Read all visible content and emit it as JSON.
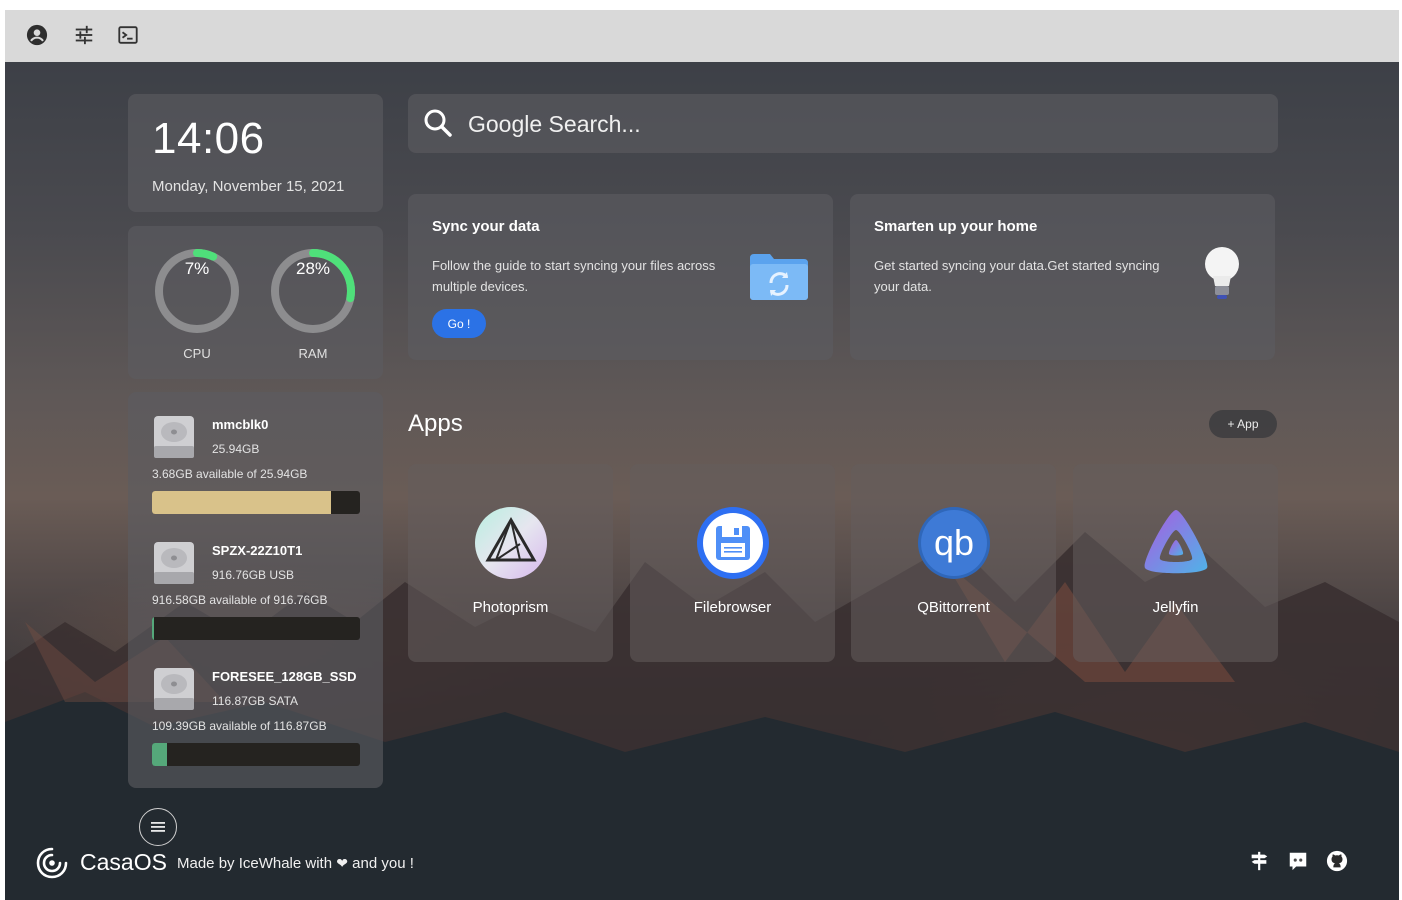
{
  "topbar": {
    "icons": [
      "account-icon",
      "sliders-icon",
      "terminal-icon"
    ]
  },
  "clock": {
    "time": "14:06",
    "date": "Monday, November 15, 2021"
  },
  "gauges": [
    {
      "label": "CPU",
      "value_text": "7%",
      "percent": 7
    },
    {
      "label": "RAM",
      "value_text": "28%",
      "percent": 28
    }
  ],
  "gauge_colors": {
    "track": "#8d8d8f",
    "fill": "#4fe07a"
  },
  "disks": [
    {
      "name": "mmcblk0",
      "size": "25.94GB",
      "available": "3.68GB available of 25.94GB",
      "used_fraction": 0.86,
      "fill_color": "#d9c28a"
    },
    {
      "name": "SPZX-22Z10T1",
      "size": "916.76GB USB",
      "available": "916.58GB available of 916.76GB",
      "used_fraction": 0.01,
      "fill_color": "#55a87a"
    },
    {
      "name": "FORESEE_128GB_SSD",
      "size": "116.87GB SATA",
      "available": "109.39GB available of 116.87GB",
      "used_fraction": 0.07,
      "fill_color": "#55a87a"
    }
  ],
  "search": {
    "placeholder": "Google Search..."
  },
  "cards": [
    {
      "title": "Sync your data",
      "description": "Follow the guide to start syncing your files across multiple devices.",
      "button": "Go !",
      "icon": "folder-sync-icon"
    },
    {
      "title": "Smarten up your home",
      "description": "Get started syncing your data.Get started syncing your data.",
      "icon": "lightbulb-icon"
    }
  ],
  "apps_section": {
    "title": "Apps",
    "add_label": "+ App"
  },
  "apps": [
    {
      "name": "Photoprism",
      "icon": "photoprism-icon"
    },
    {
      "name": "Filebrowser",
      "icon": "filebrowser-icon"
    },
    {
      "name": "QBittorrent",
      "icon": "qbittorrent-icon"
    },
    {
      "name": "Jellyfin",
      "icon": "jellyfin-icon"
    }
  ],
  "footer": {
    "brand": "CasaOS",
    "credit_prefix": "Made by IceWhale with",
    "credit_suffix": "and you !",
    "icons": [
      "signpost-icon",
      "discord-icon",
      "github-icon"
    ]
  },
  "colors": {
    "accent_blue": "#2b72e6",
    "topbar": "#d9d9d9"
  }
}
